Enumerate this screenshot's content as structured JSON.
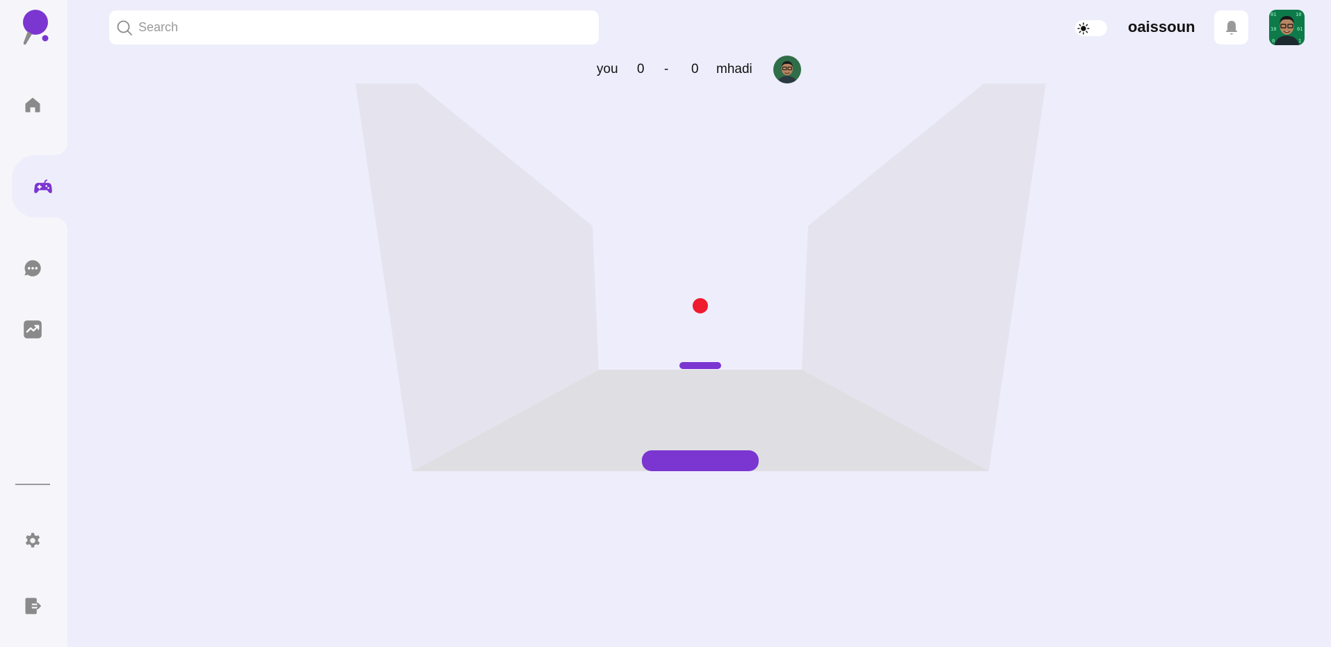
{
  "sidebar": {
    "logo_icon": "ping-pong-paddle-icon",
    "items": [
      {
        "name": "home",
        "icon": "home-icon"
      },
      {
        "name": "game",
        "icon": "gamepad-icon",
        "active": true
      },
      {
        "name": "chat",
        "icon": "chat-icon"
      },
      {
        "name": "stats",
        "icon": "trending-up-icon"
      }
    ],
    "bottom_items": [
      {
        "name": "settings",
        "icon": "gear-icon"
      },
      {
        "name": "logout",
        "icon": "logout-icon"
      }
    ]
  },
  "header": {
    "search": {
      "placeholder": "Search",
      "value": ""
    },
    "theme": "light",
    "username": "oaissoun"
  },
  "game": {
    "player_label": "you",
    "player_score": "0",
    "separator": "-",
    "opponent_score": "0",
    "opponent_name": "mhadi",
    "ball_color": "#ee1c2e",
    "paddle_color": "#7b35d1"
  },
  "colors": {
    "accent": "#7b35d1",
    "background": "#eeedfb",
    "sidebar": "#f6f6fa",
    "icon_gray": "#8a8a8a"
  }
}
